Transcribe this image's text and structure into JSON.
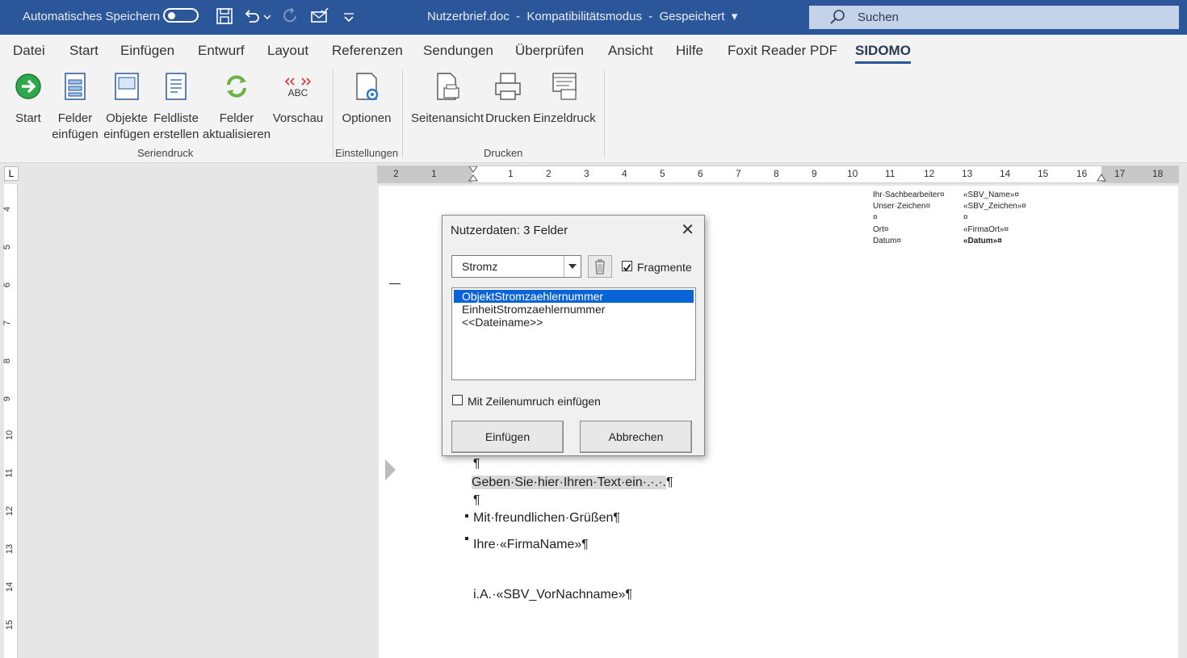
{
  "titlebar": {
    "autosave_label": "Automatisches Speichern",
    "document_title": "Nutzerbrief.doc  -  Kompatibilitätsmodus  -  Gespeichert  ▾",
    "search_placeholder": "Suchen"
  },
  "tabs": [
    "Datei",
    "Start",
    "Einfügen",
    "Entwurf",
    "Layout",
    "Referenzen",
    "Sendungen",
    "Überprüfen",
    "Ansicht",
    "Hilfe",
    "Foxit Reader PDF",
    "SIDOMO"
  ],
  "active_tab": "SIDOMO",
  "ribbon": {
    "buttons": [
      {
        "l1": "Start",
        "l2": ""
      },
      {
        "l1": "Felder",
        "l2": "einfügen"
      },
      {
        "l1": "Objekte",
        "l2": "einfügen"
      },
      {
        "l1": "Feldliste",
        "l2": "erstellen"
      },
      {
        "l1": "Felder",
        "l2": "aktualisieren"
      },
      {
        "l1": "Vorschau",
        "l2": ""
      },
      {
        "l1": "Optionen",
        "l2": ""
      },
      {
        "l1": "Seitenansicht",
        "l2": ""
      },
      {
        "l1": "Drucken",
        "l2": ""
      },
      {
        "l1": "Einzeldruck",
        "l2": ""
      }
    ],
    "groups": [
      "Seriendruck",
      "Einstellungen",
      "Drucken"
    ]
  },
  "ruler": {
    "h_labels": [
      "2",
      "1",
      "1",
      "2",
      "3",
      "4",
      "5",
      "6",
      "7",
      "8",
      "9",
      "10",
      "11",
      "12",
      "13",
      "14",
      "15",
      "16",
      "17",
      "18"
    ],
    "v_labels": [
      "4",
      "5",
      "6",
      "7",
      "8",
      "9",
      "10",
      "11",
      "12",
      "13",
      "14",
      "15"
    ],
    "corner": "L"
  },
  "doc": {
    "header_rows": [
      {
        "k": "Ihr·Sachbearbeiter¤",
        "v": "«SBV_Name»¤"
      },
      {
        "k": "Unser·Zeichen¤",
        "v": "«SBV_Zeichen»¤"
      },
      {
        "k": "¤",
        "v": "¤"
      },
      {
        "k": "Ort¤",
        "v": "«FirmaOrt»¤"
      },
      {
        "k": "Datum¤",
        "v": "«Datum»¤"
      }
    ],
    "para1": "¶",
    "para2_text": "Geben·Sie·hier·Ihren·Text·ein·.·.·.",
    "para2_mark": "¶",
    "para3": "¶",
    "para4": "Mit·freundlichen·Grüßen¶",
    "para5": "Ihre·«FirmaName»¶",
    "para6": "i.A.·«SBV_VorNachname»¶"
  },
  "dialog": {
    "title": "Nutzerdaten: 3 Felder",
    "close": "✕",
    "combo_value": "Stromz",
    "fragments_label": "Fragmente",
    "fragments_checked": true,
    "list_items": [
      "ObjektStromzaehlernummer",
      "EinheitStromzaehlernummer",
      "<<Dateiname>>"
    ],
    "selected_index": 0,
    "linebreak_label": "Mit Zeilenumruch einfügen",
    "insert_button": "Einfügen",
    "cancel_button": "Abbrechen"
  }
}
